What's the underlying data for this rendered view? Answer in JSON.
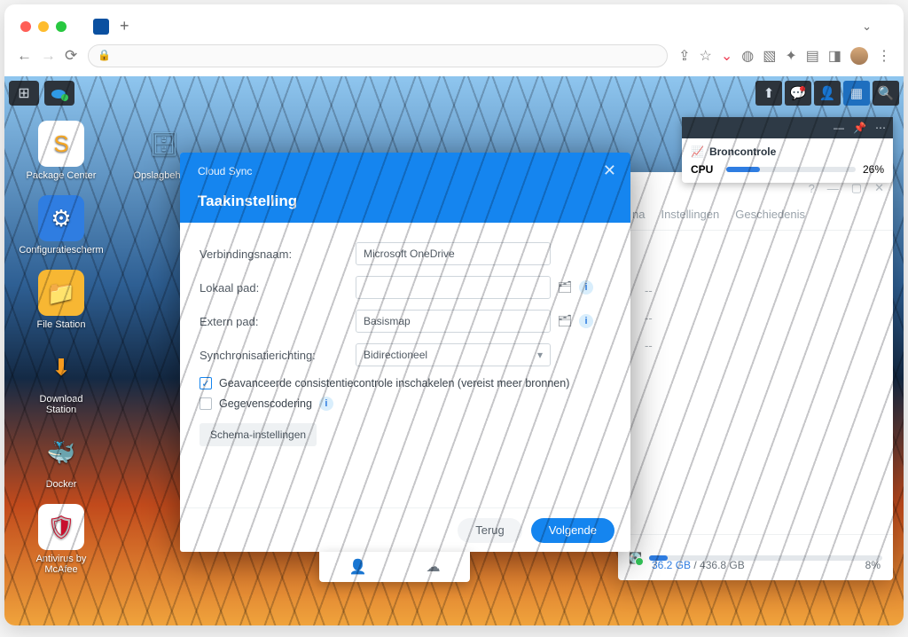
{
  "dsm_bar": {},
  "desktop": {
    "icons_col1": [
      {
        "label": "Package Center",
        "color": "#ffffff",
        "glyph": "S",
        "fg": "#f5a623"
      },
      {
        "label": "Configuratiescherm",
        "color": "#2f7de1",
        "glyph": "⚙",
        "fg": "#fff"
      },
      {
        "label": "File Station",
        "color": "#f7b733",
        "glyph": "📁",
        "fg": "#fff"
      },
      {
        "label": "Download Station",
        "color": "transparent",
        "glyph": "⬇",
        "fg": "#f79b1e"
      },
      {
        "label": "Docker",
        "color": "transparent",
        "glyph": "🐳",
        "fg": "#2496ed"
      },
      {
        "label": "Antivirus by McAfee",
        "color": "#fff",
        "glyph": "🛡",
        "fg": "#c8102e"
      }
    ],
    "icons_col2": [
      {
        "label": "Opslagbeheer",
        "color": "transparent",
        "glyph": "🗄",
        "fg": "#7bb0d8"
      }
    ]
  },
  "widget": {
    "title": "Broncontrole",
    "cpu_label": "CPU",
    "cpu_pct": "26%",
    "cpu_fill": "26%"
  },
  "bgwin": {
    "tabs": [
      "na",
      "Instellingen",
      "Geschiedenis"
    ],
    "empty": [
      "--",
      "--",
      "--"
    ],
    "vol_used": "36.2 GB",
    "vol_sep": " / ",
    "vol_total": "436.8 GB",
    "vol_pct": "8%",
    "vol_fill": "8%"
  },
  "modal": {
    "app": "Cloud Sync",
    "title": "Taakinstelling",
    "labels": {
      "conn": "Verbindingsnaam:",
      "local": "Lokaal pad:",
      "remote": "Extern pad:",
      "dir": "Synchronisatierichting:"
    },
    "values": {
      "conn": "Microsoft OneDrive",
      "local": "",
      "remote": "Basismap",
      "dir": "Bidirectioneel"
    },
    "chk_adv": "Geavanceerde consistentiecontrole inschakelen (vereist meer bronnen)",
    "chk_enc": "Gegevenscodering",
    "chip": "Schema-instellingen",
    "back": "Terug",
    "next": "Volgende"
  }
}
